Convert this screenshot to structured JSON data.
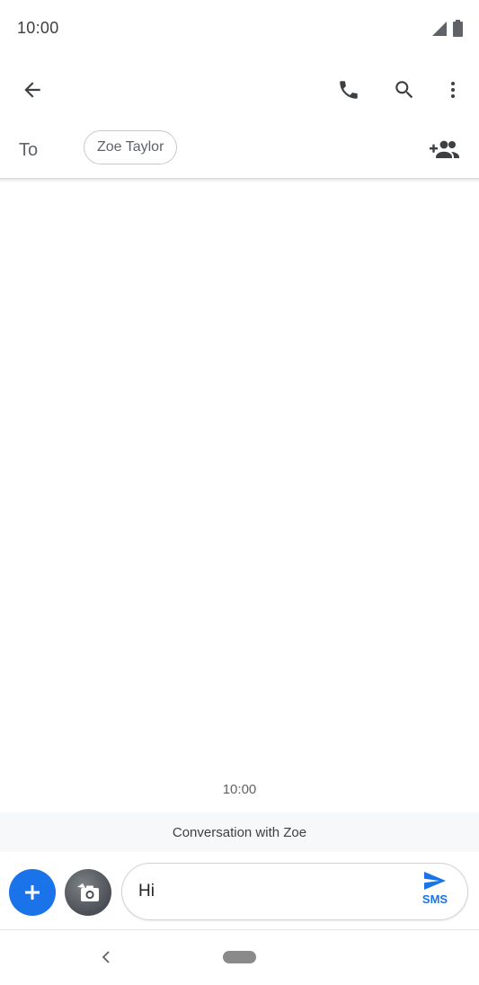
{
  "status_bar": {
    "time": "10:00",
    "icons": [
      "signal-icon",
      "battery-icon"
    ]
  },
  "toolbar": {
    "back_icon": "arrow-back-icon",
    "actions": [
      "phone-icon",
      "search-icon",
      "more-vert-icon"
    ]
  },
  "recipients": {
    "to_label": "To",
    "chips": [
      "Zoe Taylor"
    ],
    "add_icon": "add-people-icon"
  },
  "conversation": {
    "timestamp": "10:00",
    "banner": "Conversation with Zoe"
  },
  "compose": {
    "text": "Hi",
    "send_label": "SMS"
  },
  "colors": {
    "accent": "#1a73e8",
    "icon": "#3c4043"
  }
}
